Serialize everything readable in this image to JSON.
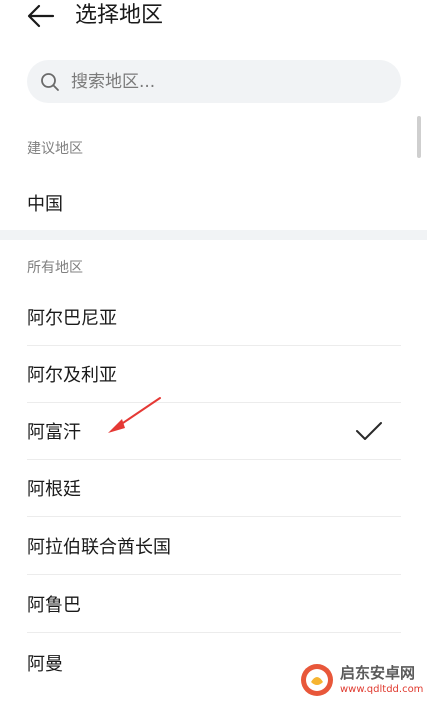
{
  "header": {
    "title": "选择地区"
  },
  "search": {
    "placeholder": "搜索地区..."
  },
  "suggested": {
    "label": "建议地区",
    "items": [
      "中国"
    ]
  },
  "all": {
    "label": "所有地区",
    "items": [
      "阿尔巴尼亚",
      "阿尔及利亚",
      "阿富汗",
      "阿根廷",
      "阿拉伯联合酋长国",
      "阿鲁巴",
      "阿曼"
    ],
    "selected_index": 2
  },
  "watermark": {
    "title": "启东安卓网",
    "url": "www.qdltdd.com"
  },
  "colors": {
    "annotation_arrow": "#e53935",
    "search_bg": "#f1f3f5",
    "watermark_brand": "#e8573a"
  },
  "icons": {
    "back": "arrow-left-icon",
    "search": "search-icon",
    "selected": "check-icon"
  }
}
